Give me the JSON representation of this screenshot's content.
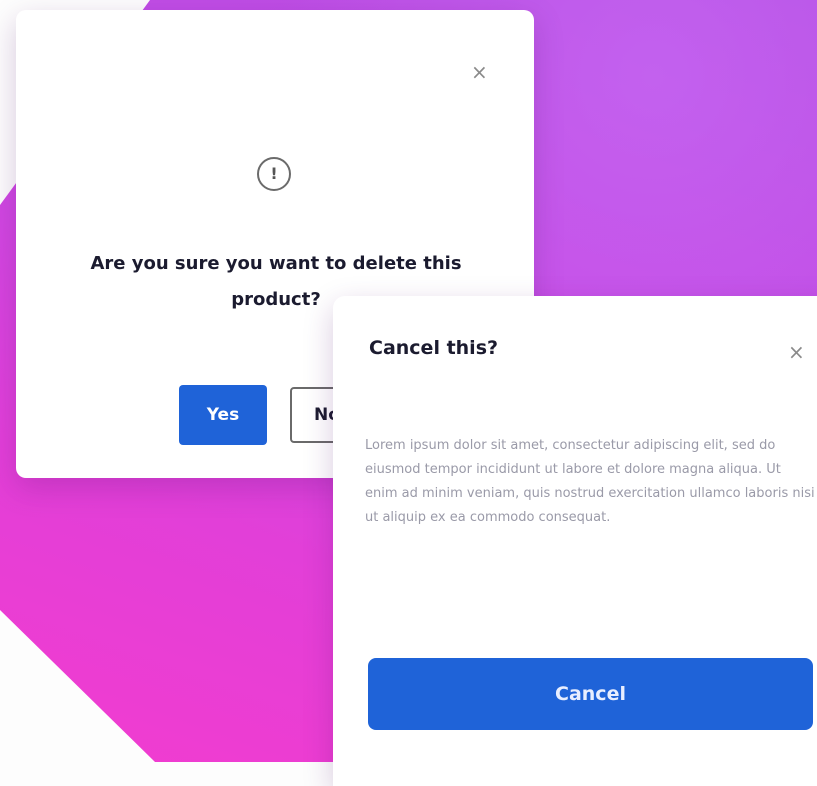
{
  "colors": {
    "background_gradient": [
      "#b64fe4",
      "#c64ce6",
      "#e23fd8",
      "#f23ccf"
    ],
    "primary_button": "#1f63d8",
    "modal_background": "#ffffff"
  },
  "confirm_dialog": {
    "close_icon": "close-icon",
    "close_glyph": "×",
    "status_icon": "info-circle-icon",
    "status_glyph": "!",
    "title": "Are you sure you want to delete this product?",
    "yes_label": "Yes",
    "no_label": "No"
  },
  "cancel_dialog": {
    "title": "Cancel this?",
    "close_icon": "close-icon",
    "close_glyph": "×",
    "body": "Lorem ipsum dolor sit amet, consectetur adipiscing elit, sed do eiusmod tempor incididunt ut labore et dolore magna aliqua. Ut enim ad minim veniam, quis nostrud exercitation ullamco laboris nisi ut aliquip ex ea commodo consequat.",
    "cancel_label": "Cancel"
  }
}
